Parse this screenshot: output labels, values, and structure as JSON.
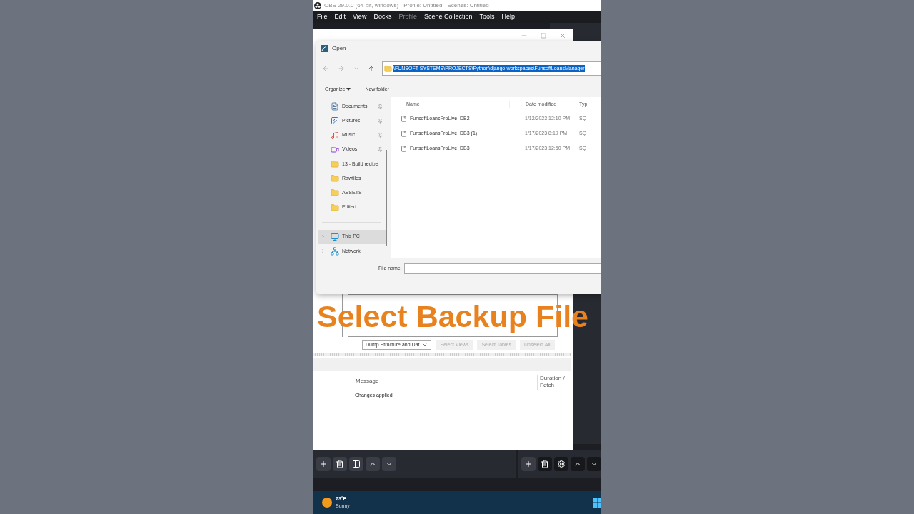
{
  "obs_window": {
    "title": "OBS 29.0.0 (64-bit, windows) - Profile: Untitled - Scenes: Untitled",
    "menu": [
      {
        "label": "File",
        "disabled": false
      },
      {
        "label": "Edit",
        "disabled": false
      },
      {
        "label": "View",
        "disabled": false
      },
      {
        "label": "Docks",
        "disabled": false
      },
      {
        "label": "Profile",
        "disabled": true
      },
      {
        "label": "Scene Collection",
        "disabled": false
      },
      {
        "label": "Tools",
        "disabled": false
      },
      {
        "label": "Help",
        "disabled": false
      }
    ]
  },
  "background_window": {
    "dump_mode": "Dump Structure and Dat",
    "buttons": [
      "Select Views",
      "Select Tables",
      "Unselect All"
    ],
    "output_columns": [
      "Message",
      "Duration / Fetch"
    ],
    "output_rows": [
      {
        "message": "Changes applied"
      }
    ]
  },
  "open_dialog": {
    "title": "Open",
    "address": "\\FUNSOFT SYSTEMS\\PROJECTS\\Python\\django-workspaces\\FunsoftLoansManager",
    "toolbar": [
      {
        "label": "Organize",
        "kind": "menu"
      },
      {
        "label": "New folder",
        "kind": "button"
      }
    ],
    "nav_pane": [
      {
        "label": "Documents",
        "kind": "documents",
        "pinned": true,
        "selected": false,
        "expandable": false
      },
      {
        "label": "Pictures",
        "kind": "pictures",
        "pinned": true,
        "selected": false,
        "expandable": false
      },
      {
        "label": "Music",
        "kind": "music",
        "pinned": true,
        "selected": false,
        "expandable": false
      },
      {
        "label": "Videos",
        "kind": "videos",
        "pinned": true,
        "selected": false,
        "expandable": false
      },
      {
        "label": "13 - Build recipe",
        "kind": "folder",
        "pinned": false,
        "selected": false,
        "expandable": false
      },
      {
        "label": "Rawfiles",
        "kind": "folder",
        "pinned": false,
        "selected": false,
        "expandable": false
      },
      {
        "label": "ASSETS",
        "kind": "folder",
        "pinned": false,
        "selected": false,
        "expandable": false
      },
      {
        "label": "Edited",
        "kind": "folder",
        "pinned": false,
        "selected": false,
        "expandable": false
      },
      {
        "label": "This PC",
        "kind": "pc",
        "pinned": false,
        "selected": true,
        "expandable": true
      },
      {
        "label": "Network",
        "kind": "network",
        "pinned": false,
        "selected": false,
        "expandable": true
      }
    ],
    "columns": [
      "Name",
      "Date modified",
      "Typ"
    ],
    "files": [
      {
        "name": "FunsoftLoansProLive_DB2",
        "date_modified": "1/12/2023 12:10 PM",
        "type": "SQ"
      },
      {
        "name": "FunsoftLoansProLive_DB3 (1)",
        "date_modified": "1/17/2023 8:19 PM",
        "type": "SQ"
      },
      {
        "name": "FunsoftLoansProLive_DB3",
        "date_modified": "1/17/2023 12:50 PM",
        "type": "SQ"
      }
    ],
    "file_name_label": "File name:"
  },
  "caption": "Select Backup File",
  "taskbar": {
    "temperature": "73°F",
    "condition": "Sunny"
  }
}
